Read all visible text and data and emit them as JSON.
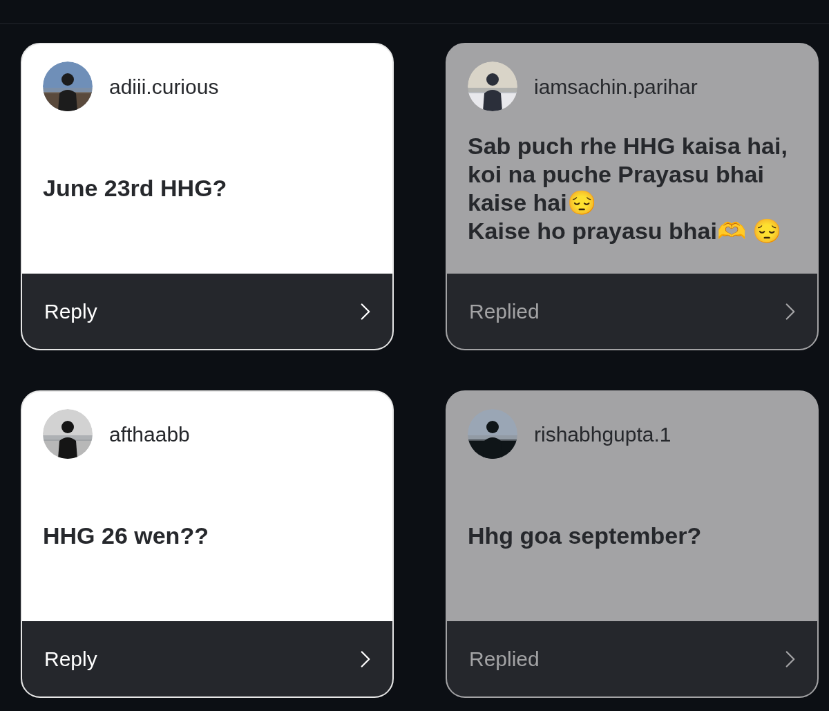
{
  "cards": [
    {
      "username": "adiii.curious",
      "message": "June 23rd HHG?",
      "replied": false,
      "action": "Reply"
    },
    {
      "username": "iamsachin.parihar",
      "message": "Sab puch rhe HHG kaisa hai, koi na puche Prayasu bhai kaise hai😔\nKaise ho prayasu bhai🫶 😔",
      "replied": true,
      "action": "Replied"
    },
    {
      "username": "afthaabb",
      "message": "HHG 26 wen??",
      "replied": false,
      "action": "Reply"
    },
    {
      "username": "rishabhgupta.1",
      "message": "Hhg goa september?",
      "replied": true,
      "action": "Replied"
    }
  ]
}
